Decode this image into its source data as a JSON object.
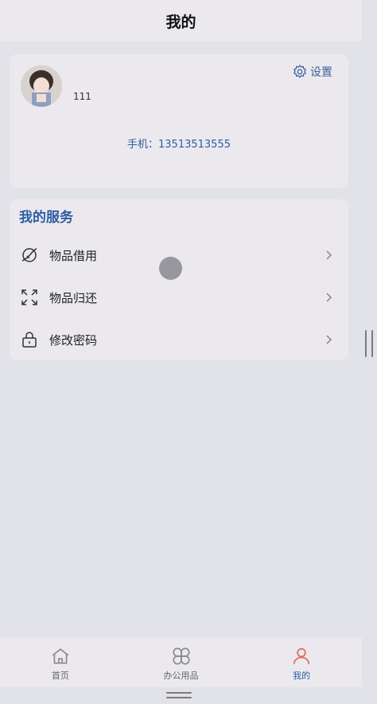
{
  "header": {
    "title": "我的"
  },
  "profile": {
    "username": "111",
    "settings_label": "设置",
    "phone_label": "手机：",
    "phone_number": "13513513555"
  },
  "services": {
    "title": "我的服务",
    "items": [
      {
        "label": "物品借用",
        "icon": "planet-icon"
      },
      {
        "label": "物品归还",
        "icon": "expand-icon"
      },
      {
        "label": "修改密码",
        "icon": "lock-icon"
      }
    ]
  },
  "bottom_nav": {
    "items": [
      {
        "label": "首页",
        "icon": "home-icon",
        "active": false
      },
      {
        "label": "办公用品",
        "icon": "grid-icon",
        "active": false
      },
      {
        "label": "我的",
        "icon": "user-icon",
        "active": true
      }
    ]
  },
  "colors": {
    "accent": "#2f5da2",
    "active_icon": "#e06a63",
    "card_bg": "#ebe9ed",
    "page_bg": "#e2e3e8"
  }
}
